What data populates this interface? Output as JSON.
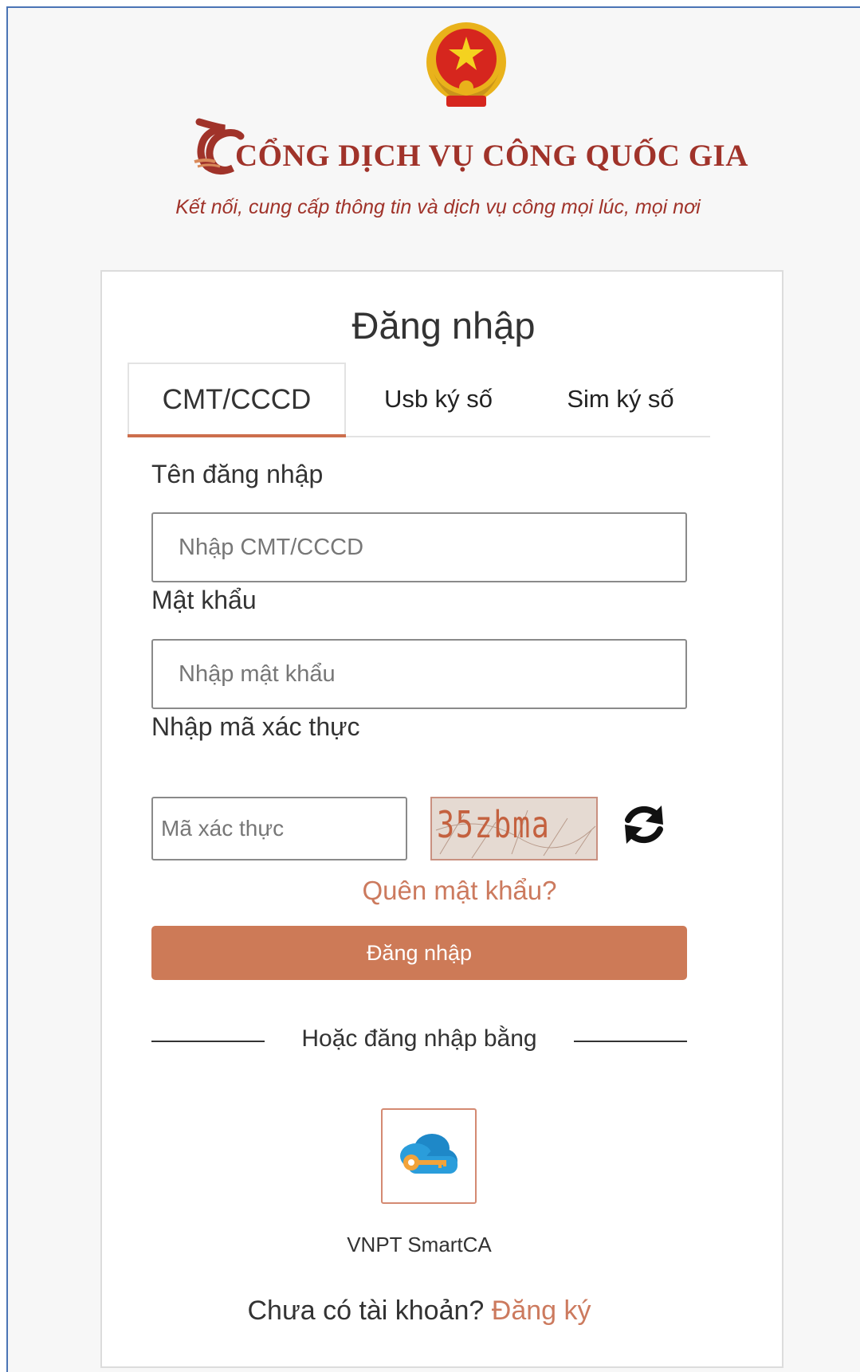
{
  "header": {
    "title": "CỔNG DỊCH VỤ CÔNG QUỐC GIA",
    "slogan": "Kết nối, cung cấp thông tin và dịch vụ công mọi lúc, mọi nơi"
  },
  "login": {
    "title": "Đăng nhập",
    "tabs": [
      {
        "label": "CMT/CCCD",
        "active": true
      },
      {
        "label": "Usb ký số",
        "active": false
      },
      {
        "label": "Sim ký số",
        "active": false
      }
    ],
    "username_label": "Tên đăng nhập",
    "username_placeholder": "Nhập CMT/CCCD",
    "password_label": "Mật khẩu",
    "password_placeholder": "Nhập mật khẩu",
    "captcha_label": "Nhập mã xác thực",
    "captcha_placeholder": "Mã xác thực",
    "captcha_text": "35zbma",
    "forgot_password": "Quên mật khẩu?",
    "submit_label": "Đăng nhập",
    "alt_login_text": "Hoặc đăng nhập bằng",
    "smartca_label": "VNPT SmartCA",
    "no_account_text": "Chưa có tài khoản?",
    "register_link": "Đăng ký"
  },
  "colors": {
    "brand": "#a0332a",
    "accent": "#cd7a57",
    "link": "#cc7a5e"
  },
  "icons": {
    "emblem": "national-emblem-icon",
    "refresh": "refresh-icon",
    "smartca": "cloud-key-icon"
  }
}
